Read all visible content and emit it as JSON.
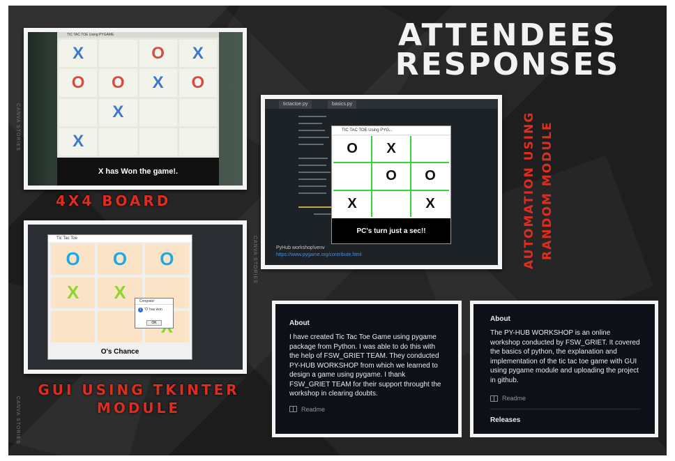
{
  "title": {
    "line1": "ATTENDEES",
    "line2": "RESPONSES"
  },
  "captions": {
    "board": "4X4 BOARD",
    "automation_line1": "AUTOMATION USING",
    "automation_line2": "RANDOM MODULE",
    "gui_line1": "GUI USING TKINTER",
    "gui_line2": "MODULE"
  },
  "photo_4x4": {
    "window_title": "TIC TAC TOE Using PYGAME",
    "cells": [
      "X",
      "",
      "O",
      "X",
      "O",
      "O",
      "X",
      "O",
      "",
      "X",
      "",
      "",
      "X",
      "",
      "",
      ""
    ],
    "status": "X has Won the game!."
  },
  "photo_automation": {
    "tabs": [
      "tictactoe.py",
      "basics.py"
    ],
    "window_title": "TIC TAC TOE Using PYG...",
    "cells": [
      "O",
      "X",
      "",
      "",
      "O",
      "O",
      "X",
      "",
      "X"
    ],
    "status": "PC's turn just a sec!!",
    "terminal_text": "PyHub workshop\\venv",
    "url_text": "https://www.pygame.org/contribute.html"
  },
  "photo_tkinter": {
    "window_title": "Tic Tac Toe",
    "cells": [
      "O",
      "O",
      "O",
      "X",
      "X",
      "",
      "",
      "",
      "X"
    ],
    "status": "O's Chance",
    "dialog_title": "Congrats!",
    "dialog_message": "'O' has won",
    "dialog_ok": "OK"
  },
  "about_left": {
    "heading": "About",
    "text": "I have created Tic Tac Toe Game using pygame package from Python. I was able to do this with the help of FSW_GRIET TEAM. They conducted PY-HUB WORKSHOP from which we learned to design a game using pygame. I thank FSW_GRIET TEAM for their support throught the workshop in clearing doubts.",
    "readme": "Readme"
  },
  "about_right": {
    "heading": "About",
    "text": "The PY-HUB WORKSHOP is an online workshop conducted by FSW_GRIET. It covered the basics of python, the explanation and implementation of the tic tac toe game with GUI using pygame module and uploading the project in github.",
    "readme": "Readme",
    "releases": "Releases"
  },
  "watermark": "CANVA STORIES",
  "colors": {
    "accent_red": "#e02b1f",
    "background": "#262626"
  }
}
